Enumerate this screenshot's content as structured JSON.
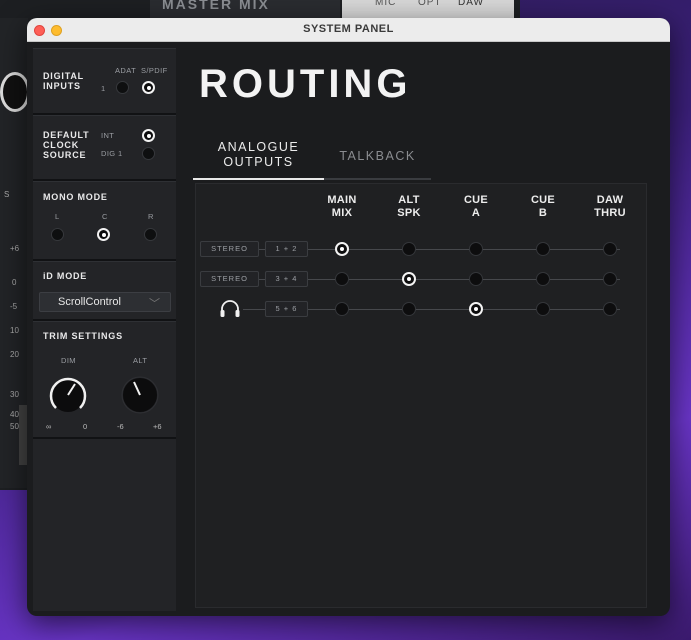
{
  "background_app": {
    "title": "MASTER MIX",
    "source_tabs": [
      "MIC",
      "OPT",
      "DAW"
    ],
    "scale_labels": [
      "S",
      "+6",
      "0",
      "-5",
      "10",
      "20",
      "30",
      "40",
      "50"
    ]
  },
  "window": {
    "title": "SYSTEM PANEL"
  },
  "sidebar": {
    "digital_inputs": {
      "title_line1": "DIGITAL",
      "title_line2": "INPUTS",
      "channel_label": "1",
      "options": [
        {
          "label": "ADAT",
          "selected": false
        },
        {
          "label": "S/PDIF",
          "selected": true
        }
      ]
    },
    "default_clock_source": {
      "title_line1": "DEFAULT",
      "title_line2": "CLOCK",
      "title_line3": "SOURCE",
      "options": [
        {
          "label": "INT",
          "selected": true
        },
        {
          "label": "DIG 1",
          "selected": false
        }
      ]
    },
    "mono_mode": {
      "title": "MONO MODE",
      "options": [
        {
          "label": "L",
          "selected": false
        },
        {
          "label": "C",
          "selected": true
        },
        {
          "label": "R",
          "selected": false
        }
      ]
    },
    "id_mode": {
      "title": "iD MODE",
      "selected_value": "ScrollControl"
    },
    "trim_settings": {
      "title": "TRIM SETTINGS",
      "dim": {
        "label": "DIM",
        "min_label": "∞",
        "max_label": "0"
      },
      "alt": {
        "label": "ALT",
        "min_label": "-6",
        "max_label": "+6"
      }
    }
  },
  "main": {
    "title": "ROUTING",
    "tabs": [
      {
        "line1": "ANALOGUE",
        "line2": "OUTPUTS",
        "active": true
      },
      {
        "line1": "TALKBACK",
        "active": false
      }
    ],
    "columns": [
      {
        "line1": "MAIN",
        "line2": "MIX"
      },
      {
        "line1": "ALT",
        "line2": "SPK"
      },
      {
        "line1": "CUE",
        "line2": "A"
      },
      {
        "line1": "CUE",
        "line2": "B"
      },
      {
        "line1": "DAW",
        "line2": "THRU"
      }
    ],
    "rows": [
      {
        "type_label": "STEREO",
        "channels": "1 + 2",
        "selected_column": 0
      },
      {
        "type_label": "STEREO",
        "channels": "3 + 4",
        "selected_column": 1
      },
      {
        "type_icon": "headphones-icon",
        "channels": "5 + 6",
        "selected_column": 2
      }
    ]
  },
  "colors": {
    "window_bg": "#1b1c1e",
    "sidebar_bg": "#232427",
    "selected": "#f3f3f3",
    "titlebar": "#ececec"
  }
}
